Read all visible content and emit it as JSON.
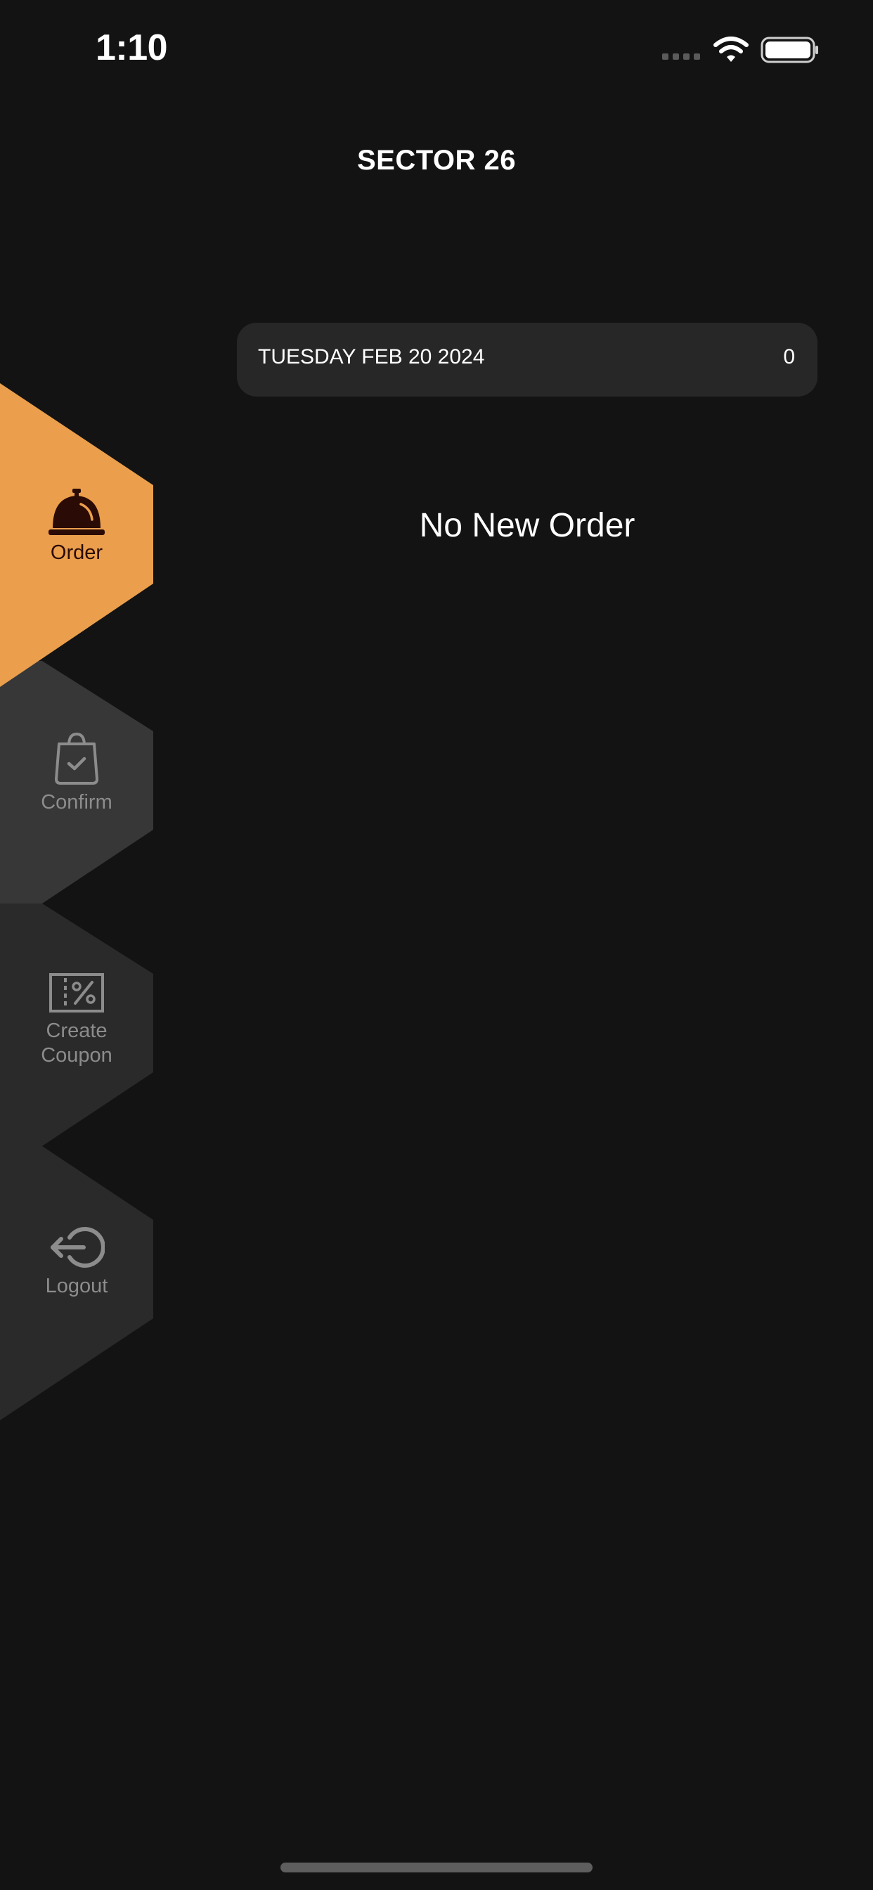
{
  "status_bar": {
    "time": "1:10"
  },
  "header": {
    "title": "SECTOR 26"
  },
  "date_bar": {
    "date": "TUESDAY FEB 20 2024",
    "count": "0"
  },
  "main": {
    "empty_message": "No New Order"
  },
  "sidebar": {
    "items": [
      {
        "label": "Order",
        "icon": "bell-icon",
        "active": true
      },
      {
        "label": "Confirm",
        "icon": "shopping-bag-check-icon",
        "active": false
      },
      {
        "label": "Create\nCoupon",
        "icon": "coupon-icon",
        "active": false
      },
      {
        "label": "Logout",
        "icon": "logout-icon",
        "active": false
      }
    ]
  },
  "colors": {
    "background": "#131313",
    "active_tab": "#eb9f4c",
    "inactive_tab": "#2a2a2a",
    "date_bar": "#272727",
    "inactive_text": "#8c8c8c",
    "active_text": "#2b0b05"
  }
}
